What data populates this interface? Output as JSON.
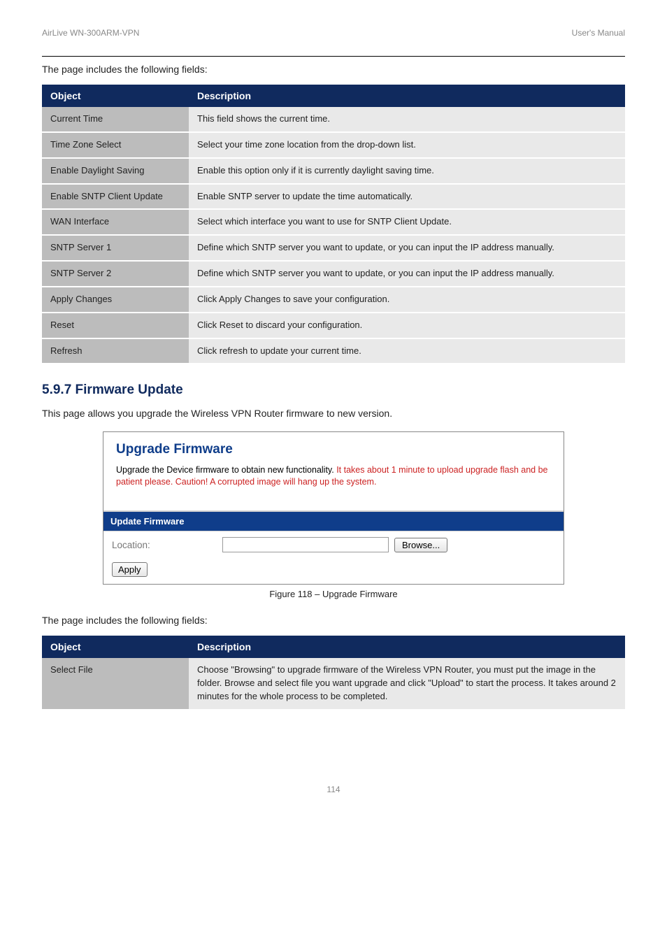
{
  "header": {
    "left": "AirLive WN-300ARM-VPN",
    "right": "User's Manual"
  },
  "intro1": "The page includes the following fields:",
  "table1": {
    "h_obj": "Object",
    "h_desc": "Description",
    "rows": [
      {
        "label": "Current Time",
        "desc": "This field shows the current time."
      },
      {
        "label": "Time Zone Select",
        "desc": "Select your time zone location from the drop-down list."
      },
      {
        "label": "Enable Daylight Saving",
        "desc": "Enable this option only if it is currently daylight saving time."
      },
      {
        "label": "Enable SNTP Client Update",
        "desc": "Enable SNTP server to update the time automatically."
      },
      {
        "label": "WAN Interface",
        "desc": "Select which interface you want to use for SNTP Client Update."
      },
      {
        "label": "SNTP Server 1",
        "desc": "Define which SNTP server you want to update, or you can input the IP address manually."
      },
      {
        "label": "SNTP Server 2",
        "desc": "Define which SNTP server you want to update, or you can input the IP address manually."
      },
      {
        "label": "Apply Changes",
        "desc": "Click Apply Changes to save your configuration."
      },
      {
        "label": "Reset",
        "desc": "Click Reset to discard your configuration."
      },
      {
        "label": "Refresh",
        "desc": "Click refresh to update your current time."
      }
    ]
  },
  "section2_title": "5.9.7 Firmware Update",
  "section2_intro": "This page allows you upgrade the Wireless VPN Router firmware to new version.",
  "figure": {
    "title": "Upgrade Firmware",
    "desc_black": "Upgrade the Device firmware to obtain new functionality.",
    "desc_red": " It takes about 1 minute to upload  upgrade flash and be patient please. Caution! A corrupted image will hang up the system.",
    "band": "Update Firmware",
    "location_label": "Location:",
    "location_value": "",
    "browse": "Browse...",
    "apply": "Apply"
  },
  "caption": "Figure 118 – Upgrade Firmware",
  "intro2": "The page includes the following fields:",
  "table2": {
    "h_obj": "Object",
    "h_desc": "Description",
    "rows": [
      {
        "label": "Select File",
        "desc": "Choose \"Browsing\" to upgrade firmware of the Wireless VPN Router, you must put the image in the folder. Browse and select file you want upgrade and click \"Upload\" to start the process. It takes around 2 minutes for the whole process to be completed."
      }
    ]
  },
  "page_number": "114"
}
